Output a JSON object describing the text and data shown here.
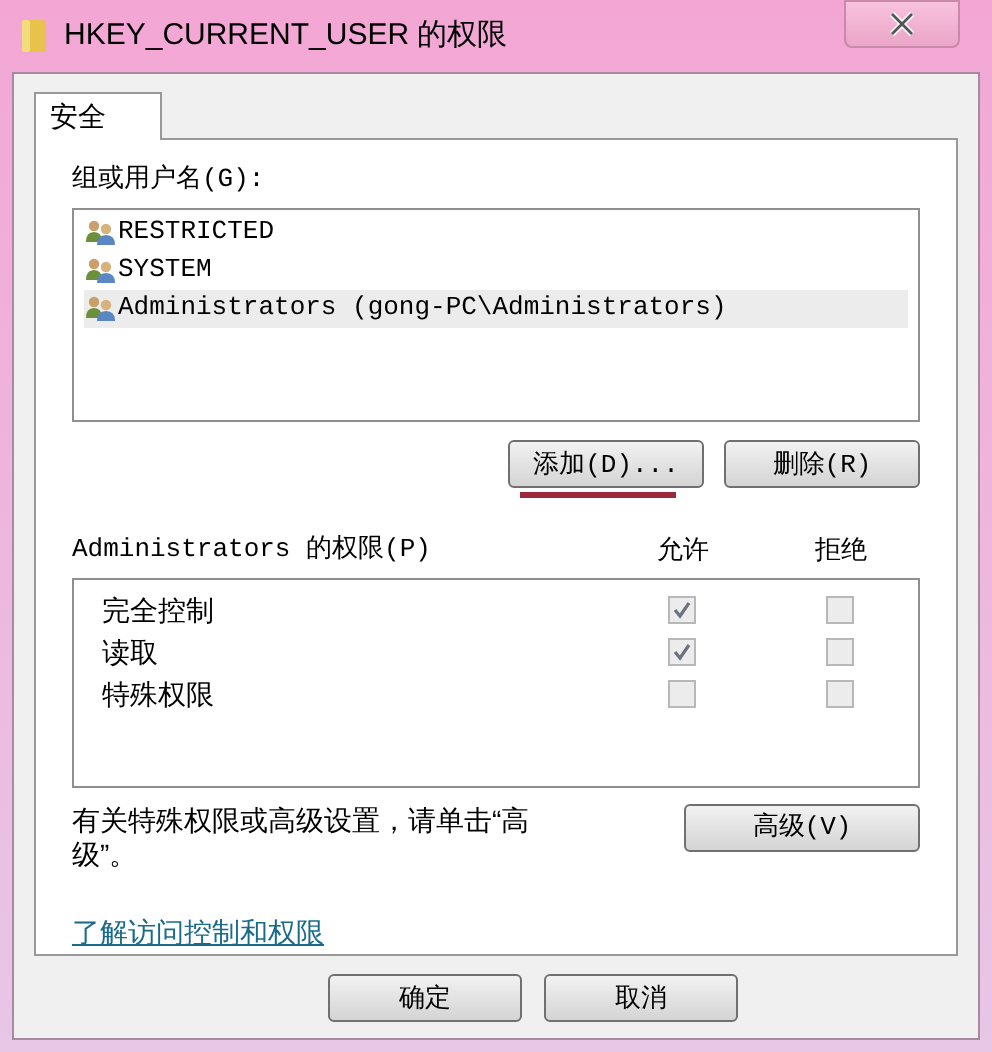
{
  "window": {
    "title": "HKEY_CURRENT_USER 的权限"
  },
  "tabs": [
    {
      "label": "安全",
      "selected": true
    }
  ],
  "principals_label": "组或用户名(G):",
  "principals": [
    {
      "name": "RESTRICTED",
      "selected": false
    },
    {
      "name": "SYSTEM",
      "selected": false
    },
    {
      "name": "Administrators (gong-PC\\Administrators)",
      "selected": true
    }
  ],
  "principal_buttons": [
    "添加(D)...",
    "删除(R)"
  ],
  "permissions": {
    "header": "Administrators 的权限(P)",
    "allow_header": "允许",
    "deny_header": "拒绝",
    "rows": [
      {
        "name": "完全控制",
        "allow": true,
        "deny": false
      },
      {
        "name": "读取",
        "allow": true,
        "deny": false
      },
      {
        "name": "特殊权限",
        "allow": false,
        "deny": false
      }
    ]
  },
  "advanced_note": "有关特殊权限或高级设置，请单击“高级”。",
  "advanced_button": "高级(V)",
  "help_link": "了解访问控制和权限",
  "footer_buttons": [
    "确定",
    "取消"
  ]
}
